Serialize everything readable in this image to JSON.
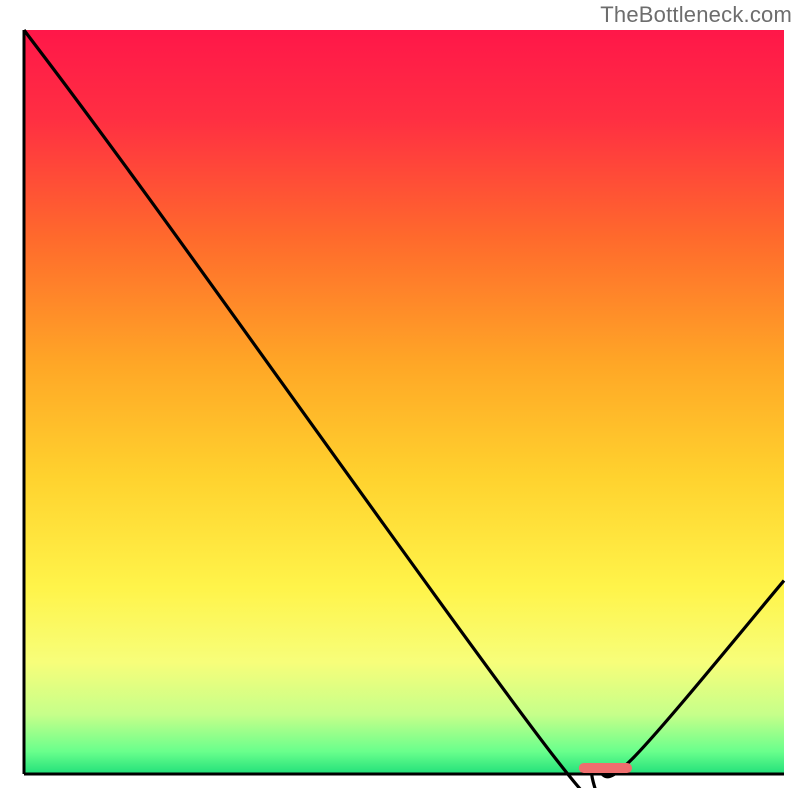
{
  "watermark": "TheBottleneck.com",
  "chart_data": {
    "type": "line",
    "title": "",
    "xlabel": "",
    "ylabel": "",
    "xlim": [
      0,
      100
    ],
    "ylim": [
      0,
      100
    ],
    "series": [
      {
        "name": "curve",
        "x": [
          0,
          16,
          70,
          75,
          80,
          100
        ],
        "values": [
          100,
          78,
          2,
          0.5,
          2,
          26
        ]
      }
    ],
    "marker": {
      "x_start": 73,
      "x_end": 80,
      "y": 0.8
    },
    "gradient_stops": [
      {
        "offset": 0.0,
        "color": "#ff1749"
      },
      {
        "offset": 0.12,
        "color": "#ff2f42"
      },
      {
        "offset": 0.28,
        "color": "#ff6a2c"
      },
      {
        "offset": 0.45,
        "color": "#ffa726"
      },
      {
        "offset": 0.6,
        "color": "#ffd22e"
      },
      {
        "offset": 0.75,
        "color": "#fff44a"
      },
      {
        "offset": 0.85,
        "color": "#f7fe7a"
      },
      {
        "offset": 0.92,
        "color": "#c6ff8a"
      },
      {
        "offset": 0.97,
        "color": "#69ff8c"
      },
      {
        "offset": 1.0,
        "color": "#22e07a"
      }
    ],
    "marker_color": "#ef6e6e",
    "line_color": "#000000",
    "axis_color": "#000000"
  }
}
